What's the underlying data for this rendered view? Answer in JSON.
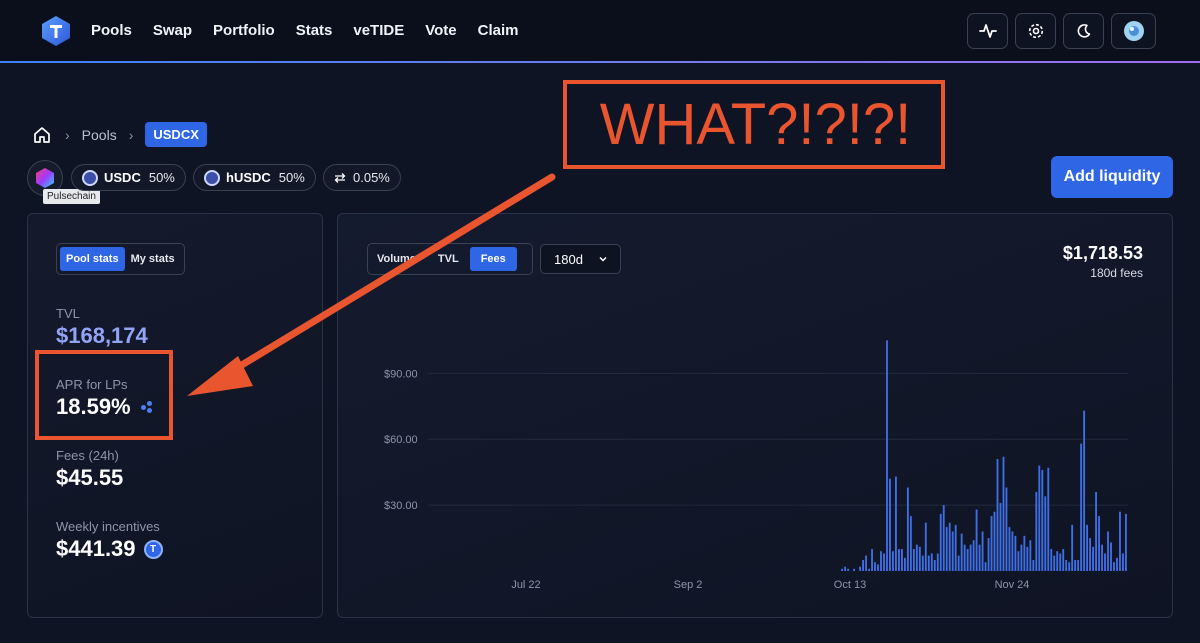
{
  "nav": {
    "links": [
      "Pools",
      "Swap",
      "Portfolio",
      "Stats",
      "veTIDE",
      "Vote",
      "Claim"
    ]
  },
  "breadcrumb": {
    "parent": "Pools",
    "current": "USDCX"
  },
  "pool": {
    "chain_tooltip": "Pulsechain",
    "tokens": [
      {
        "symbol": "USDC",
        "weight": "50%"
      },
      {
        "symbol": "hUSDC",
        "weight": "50%"
      }
    ],
    "swap_fee": "0.05%",
    "add_liquidity_label": "Add liquidity"
  },
  "stats": {
    "tabs": [
      "Pool stats",
      "My stats"
    ],
    "tvl_label": "TVL",
    "tvl_value": "$168,174",
    "apr_label": "APR for LPs",
    "apr_value": "18.59%",
    "fees_label": "Fees (24h)",
    "fees_value": "$45.55",
    "incentives_label": "Weekly incentives",
    "incentives_value": "$441.39"
  },
  "chart": {
    "tabs": [
      "Volume",
      "TVL",
      "Fees"
    ],
    "active_tab": "Fees",
    "range": "180d",
    "total_value": "$1,718.53",
    "total_caption": "180d fees"
  },
  "annotation": {
    "text": "WHAT?!?!?!"
  },
  "colors": {
    "accent": "#2f66e6",
    "bar": "#3f6fe6",
    "annotation": "#e8552f"
  },
  "chart_data": {
    "type": "bar",
    "y_ticks": [
      "$30.00",
      "$60.00",
      "$90.00"
    ],
    "x_ticks": [
      "Jul 22",
      "Sep 2",
      "Oct 13",
      "Nov 24"
    ],
    "ylim": [
      0,
      107
    ],
    "values": [
      0,
      0,
      0,
      0,
      0,
      0,
      0,
      0,
      0,
      0,
      0,
      0,
      0,
      0,
      0,
      0,
      0,
      0,
      0,
      0,
      0,
      0,
      0,
      0,
      0,
      0,
      0,
      0,
      0,
      0,
      0,
      0,
      0,
      0,
      0,
      0,
      0,
      0,
      0,
      0,
      0,
      0,
      0,
      0,
      0,
      0,
      0,
      0,
      0,
      0,
      0,
      0,
      0,
      0,
      0,
      0,
      0,
      0,
      0,
      0,
      0,
      0,
      0,
      0,
      0,
      0,
      0,
      0,
      0,
      0,
      0,
      0,
      0,
      0,
      0,
      0,
      0,
      0,
      0,
      0,
      0,
      0,
      0,
      0,
      0,
      0,
      0,
      0,
      0,
      0,
      0,
      0,
      0,
      0,
      0,
      0,
      0,
      0,
      0,
      0,
      0,
      0,
      0,
      0,
      0,
      0,
      0,
      0,
      0,
      0,
      0,
      0,
      0,
      0,
      0,
      0,
      0,
      0,
      0,
      0,
      0,
      0,
      0,
      0,
      0,
      0,
      0,
      0,
      0,
      0,
      0,
      0,
      0,
      0,
      0,
      1,
      2,
      1,
      0,
      1,
      0,
      2,
      5,
      7,
      1,
      10,
      4,
      3,
      9,
      8,
      105,
      42,
      9,
      43,
      10,
      10,
      6,
      38,
      25,
      10,
      12,
      11,
      7,
      22,
      7,
      8,
      5,
      8,
      26,
      30,
      20,
      22,
      18,
      21,
      7,
      17,
      12,
      10,
      12,
      14,
      28,
      12,
      18,
      4,
      15,
      25,
      27,
      51,
      31,
      52,
      38,
      20,
      18,
      16,
      9,
      12,
      16,
      11,
      14,
      5,
      36,
      48,
      46,
      34,
      47,
      10,
      7,
      9,
      8,
      10,
      5,
      4,
      21,
      5,
      5,
      58,
      73,
      21,
      15,
      11,
      36,
      25,
      12,
      8,
      18,
      13,
      4,
      6,
      27,
      8,
      26
    ]
  }
}
